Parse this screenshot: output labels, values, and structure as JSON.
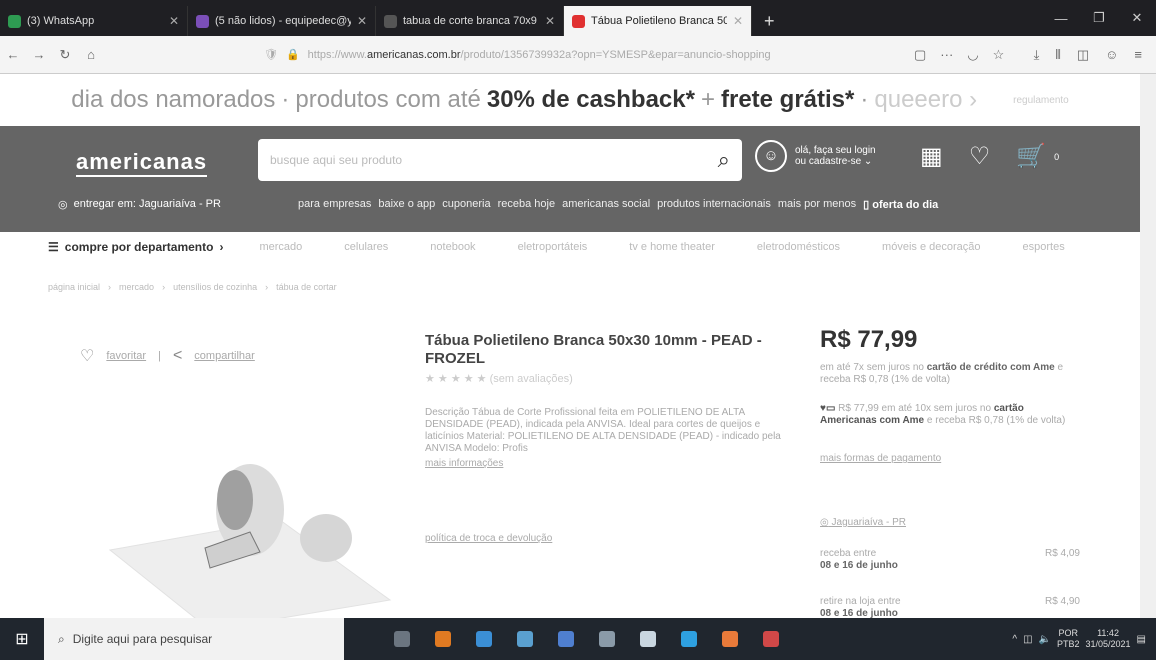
{
  "browser": {
    "tabs": [
      {
        "title": "(3) WhatsApp",
        "icon": "whatsapp-icon",
        "color": "#2e9b52"
      },
      {
        "title": "(5 não lidos) - equipedec@y...",
        "icon": "mail-icon",
        "color": "#7b4fb8"
      },
      {
        "title": "tabua de corte branca 70x9 - ...",
        "icon": "search-icon",
        "color": "#555555"
      },
      {
        "title": "Tábua Polietileno Branca 50x...",
        "icon": "store-icon",
        "color": "#e03030"
      }
    ],
    "new_tab": "+",
    "url_domain": "americanas.com.br",
    "url_prefix": "https://www.",
    "url_rest": "/produto/1356739932a?opn=YSMESP&epar=anuncio-shopping"
  },
  "promo": {
    "left": "dia dos namorados",
    "mid": "produtos com até",
    "cashback": "30% de cashback*",
    "plus": "+",
    "frete": "frete grátis*",
    "cta": "queeero ›",
    "regulamento": "regulamento"
  },
  "header": {
    "logo": "americanas",
    "search_placeholder": "busque aqui seu produto",
    "login_line1": "olá, faça seu login",
    "login_line2": "ou cadastre-se",
    "cart_count": "0",
    "deliver": "entregar em: Jaguariaíva - PR",
    "nav": [
      "para empresas",
      "baixe o app",
      "cuponeria",
      "receba hoje",
      "americanas social",
      "produtos internacionais",
      "mais por menos"
    ],
    "offer": "oferta do dia"
  },
  "categories": {
    "first": "compre por departamento",
    "items": [
      "mercado",
      "celulares",
      "notebook",
      "eletroportáteis",
      "tv e home theater",
      "eletrodomésticos",
      "móveis e decoração",
      "esportes"
    ]
  },
  "breadcrumb": [
    "página inicial",
    "mercado",
    "utensílios de cozinha",
    "tábua de cortar"
  ],
  "product": {
    "favorite": "favoritar",
    "share": "compartilhar",
    "title": "Tábua Polietileno Branca 50x30 10mm - PEAD - FROZEL",
    "rating_text": "(sem avaliações)",
    "description": "Descrição Tábua de Corte Profissional feita em POLIETILENO DE ALTA DENSIDADE (PEAD), indicada pela ANVISA. Ideal para cortes de queijos e laticínios Material: POLIETILENO DE ALTA DENSIDADE (PEAD) - indicado pela ANVISA Modelo: Profis",
    "more_info": "mais informações",
    "policy": "política de troca e devolução"
  },
  "pricing": {
    "price": "R$ 77,99",
    "installment_a": "em até 7x sem juros no",
    "installment_b": "cartão de crédito com Ame",
    "installment_c": "e receba R$ 0,78 (1% de volta)",
    "ame_a": "R$ 77,99 em até 10x sem juros no",
    "ame_b": "cartão Americanas com Ame",
    "ame_c": "e receba R$ 0,78 (1% de volta)",
    "payment_link": "mais formas de pagamento",
    "ship_loc": "Jaguariaíva - PR",
    "deliveries": [
      {
        "label": "receba entre",
        "dates": "08 e 16 de junho",
        "value": "R$ 4,09"
      },
      {
        "label": "retire na loja entre",
        "dates": "08 e 16 de junho",
        "value": "R$ 4,90"
      }
    ]
  },
  "taskbar": {
    "search_placeholder": "Digite aqui para pesquisar",
    "lang1": "POR",
    "lang2": "PTB2",
    "time": "11:42",
    "date": "31/05/2021",
    "apps": [
      "#6b7580",
      "#e07a22",
      "#3b8fd6",
      "#5aa0d0",
      "#4f7fd0",
      "#8a9aa8",
      "#c9d6e0",
      "#2ea0e0",
      "#e87a3a",
      "#d04848"
    ]
  },
  "colors": {
    "header_bg": "#656565",
    "tabbar_bg": "#1f1f23",
    "taskbar_bg": "#20262e"
  }
}
